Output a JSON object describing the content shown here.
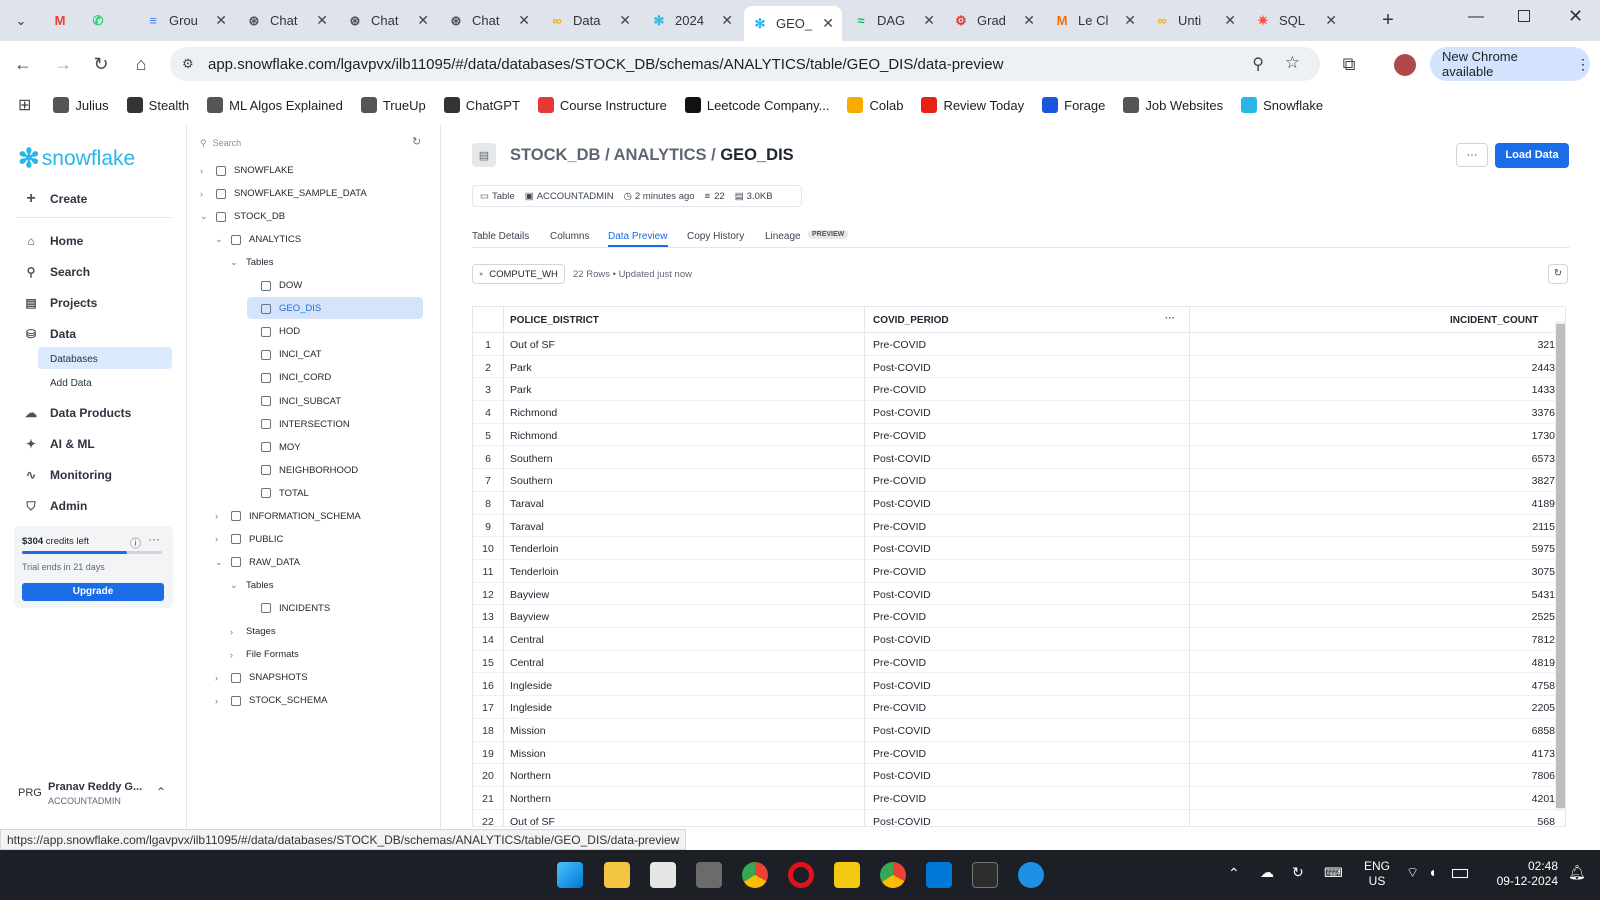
{
  "browser": {
    "tabs": [
      {
        "label": "",
        "color": "#ea4335",
        "glyph": "M"
      },
      {
        "label": "",
        "color": "#25d366",
        "glyph": "✆"
      },
      {
        "label": "Grou",
        "color": "#4285f4",
        "glyph": "≡"
      },
      {
        "label": "Chat",
        "color": "#555",
        "glyph": "⊛"
      },
      {
        "label": "Chat",
        "color": "#555",
        "glyph": "⊛"
      },
      {
        "label": "Chat",
        "color": "#555",
        "glyph": "⊛"
      },
      {
        "label": "Data",
        "color": "#f9ab00",
        "glyph": "∞"
      },
      {
        "label": "2024",
        "color": "#29b5e8",
        "glyph": "✻"
      },
      {
        "label": "GEO_",
        "color": "#29b5e8",
        "glyph": "✻"
      },
      {
        "label": "DAG",
        "color": "#00c853",
        "glyph": "≈"
      },
      {
        "label": "Grad",
        "color": "#e53935",
        "glyph": "⚙"
      },
      {
        "label": "Le Cl",
        "color": "#ff6d00",
        "glyph": "M"
      },
      {
        "label": "Unti",
        "color": "#f9ab00",
        "glyph": "∞"
      },
      {
        "label": "SQL",
        "color": "#e9573f",
        "glyph": "✷"
      }
    ],
    "url": "app.snowflake.com/lgavpvx/ilb11095/#/data/databases/STOCK_DB/schemas/ANALYTICS/table/GEO_DIS/data-preview",
    "update_label": "New Chrome available",
    "bookmarks": [
      {
        "label": "Julius",
        "color": "#555"
      },
      {
        "label": "Stealth",
        "color": "#333"
      },
      {
        "label": "ML Algos Explained",
        "color": "#555"
      },
      {
        "label": "TrueUp",
        "color": "#555"
      },
      {
        "label": "ChatGPT",
        "color": "#333"
      },
      {
        "label": "Course Instructure",
        "color": "#e53935"
      },
      {
        "label": "Leetcode Company...",
        "color": "#111"
      },
      {
        "label": "Colab",
        "color": "#f9ab00"
      },
      {
        "label": "Review Today",
        "color": "#e62117"
      },
      {
        "label": "Forage",
        "color": "#1a56db"
      },
      {
        "label": "Job Websites",
        "color": "#555"
      },
      {
        "label": "Snowflake",
        "color": "#29b5e8"
      }
    ],
    "status_url": "https://app.snowflake.com/lgavpvx/ilb11095/#/data/databases/STOCK_DB/schemas/ANALYTICS/table/GEO_DIS/data-preview"
  },
  "sidebar": {
    "brand": "snowflake",
    "create": "Create",
    "items": [
      "Home",
      "Search",
      "Projects",
      "Data"
    ],
    "data_sub": [
      "Databases",
      "Add Data"
    ],
    "items2": [
      "Data Products",
      "AI & ML",
      "Monitoring",
      "Admin"
    ],
    "credits": "$304",
    "credits_suffix": "credits left",
    "credits_fraction": 0.75,
    "trial": "Trial ends in 21 days",
    "upgrade": "Upgrade",
    "user_initials": "PRG",
    "user_name": "Pranav Reddy G...",
    "user_role": "ACCOUNTADMIN"
  },
  "tree": {
    "search_placeholder": "Search",
    "nodes": [
      {
        "label": "SNOWFLAKE",
        "caret": "›",
        "indent": 0
      },
      {
        "label": "SNOWFLAKE_SAMPLE_DATA",
        "caret": "›",
        "indent": 0
      },
      {
        "label": "STOCK_DB",
        "caret": "⌄",
        "indent": 0
      },
      {
        "label": "ANALYTICS",
        "caret": "⌄",
        "indent": 1
      },
      {
        "label": "Tables",
        "caret": "⌄",
        "indent": 2
      },
      {
        "label": "DOW",
        "caret": "",
        "indent": 3
      },
      {
        "label": "GEO_DIS",
        "caret": "",
        "indent": 3,
        "selected": true
      },
      {
        "label": "HOD",
        "caret": "",
        "indent": 3
      },
      {
        "label": "INCI_CAT",
        "caret": "",
        "indent": 3
      },
      {
        "label": "INCI_CORD",
        "caret": "",
        "indent": 3
      },
      {
        "label": "INCI_SUBCAT",
        "caret": "",
        "indent": 3
      },
      {
        "label": "INTERSECTION",
        "caret": "",
        "indent": 3
      },
      {
        "label": "MOY",
        "caret": "",
        "indent": 3
      },
      {
        "label": "NEIGHBORHOOD",
        "caret": "",
        "indent": 3
      },
      {
        "label": "TOTAL",
        "caret": "",
        "indent": 3
      },
      {
        "label": "INFORMATION_SCHEMA",
        "caret": "›",
        "indent": 1
      },
      {
        "label": "PUBLIC",
        "caret": "›",
        "indent": 1
      },
      {
        "label": "RAW_DATA",
        "caret": "⌄",
        "indent": 1
      },
      {
        "label": "Tables",
        "caret": "⌄",
        "indent": 2
      },
      {
        "label": "INCIDENTS",
        "caret": "",
        "indent": 3
      },
      {
        "label": "Stages",
        "caret": "›",
        "indent": 2
      },
      {
        "label": "File Formats",
        "caret": "›",
        "indent": 2
      },
      {
        "label": "SNAPSHOTS",
        "caret": "›",
        "indent": 1
      },
      {
        "label": "STOCK_SCHEMA",
        "caret": "›",
        "indent": 1
      }
    ]
  },
  "main": {
    "breadcrumb_db": "STOCK_DB",
    "breadcrumb_schema": "ANALYTICS",
    "breadcrumb_table": "GEO_DIS",
    "sep": "/",
    "more": "···",
    "load_data": "Load Data",
    "meta_type": "Table",
    "meta_owner": "ACCOUNTADMIN",
    "meta_time": "2 minutes ago",
    "meta_rows": "22",
    "meta_size": "3.0KB",
    "tabs": [
      "Table Details",
      "Columns",
      "Data Preview",
      "Copy History",
      "Lineage"
    ],
    "lineage_badge": "PREVIEW",
    "warehouse": "COMPUTE_WH",
    "rows_info": "22 Rows • Updated just now",
    "columns": [
      "POLICE_DISTRICT",
      "COVID_PERIOD",
      "INCIDENT_COUNT"
    ],
    "rows": [
      [
        "1",
        "Out of SF",
        "Pre-COVID",
        "321"
      ],
      [
        "2",
        "Park",
        "Post-COVID",
        "2443"
      ],
      [
        "3",
        "Park",
        "Pre-COVID",
        "1433"
      ],
      [
        "4",
        "Richmond",
        "Post-COVID",
        "3376"
      ],
      [
        "5",
        "Richmond",
        "Pre-COVID",
        "1730"
      ],
      [
        "6",
        "Southern",
        "Post-COVID",
        "6573"
      ],
      [
        "7",
        "Southern",
        "Pre-COVID",
        "3827"
      ],
      [
        "8",
        "Taraval",
        "Post-COVID",
        "4189"
      ],
      [
        "9",
        "Taraval",
        "Pre-COVID",
        "2115"
      ],
      [
        "10",
        "Tenderloin",
        "Post-COVID",
        "5975"
      ],
      [
        "11",
        "Tenderloin",
        "Pre-COVID",
        "3075"
      ],
      [
        "12",
        "Bayview",
        "Post-COVID",
        "5431"
      ],
      [
        "13",
        "Bayview",
        "Pre-COVID",
        "2525"
      ],
      [
        "14",
        "Central",
        "Post-COVID",
        "7812"
      ],
      [
        "15",
        "Central",
        "Pre-COVID",
        "4819"
      ],
      [
        "16",
        "Ingleside",
        "Post-COVID",
        "4758"
      ],
      [
        "17",
        "Ingleside",
        "Pre-COVID",
        "2205"
      ],
      [
        "18",
        "Mission",
        "Post-COVID",
        "6858"
      ],
      [
        "19",
        "Mission",
        "Pre-COVID",
        "4173"
      ],
      [
        "20",
        "Northern",
        "Post-COVID",
        "7806"
      ],
      [
        "21",
        "Northern",
        "Pre-COVID",
        "4201"
      ],
      [
        "22",
        "Out of SF",
        "Post-COVID",
        "568"
      ]
    ]
  },
  "taskbar": {
    "lang1": "ENG",
    "lang2": "US",
    "time": "02:48",
    "date": "09-12-2024"
  }
}
